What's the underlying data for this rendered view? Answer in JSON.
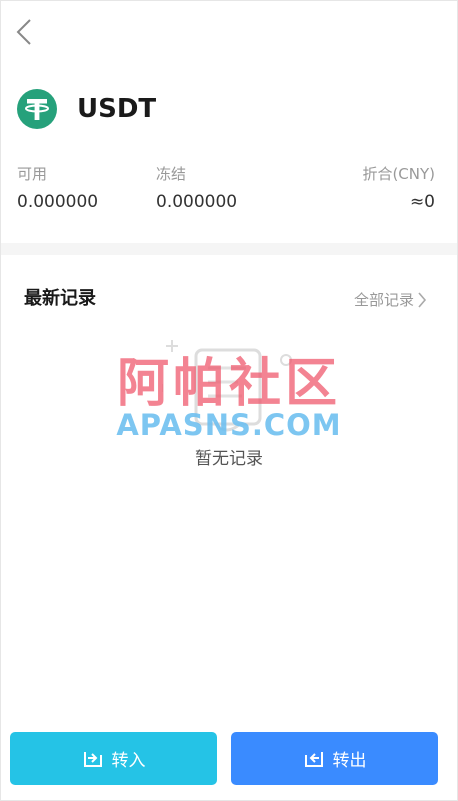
{
  "header": {
    "back_icon": "chevron-left-icon"
  },
  "coin": {
    "name": "USDT",
    "icon": "tether-icon",
    "icon_color": "#26a17b"
  },
  "stats": {
    "available": {
      "label": "可用",
      "value": "0.000000"
    },
    "frozen": {
      "label": "冻结",
      "value": "0.000000"
    },
    "converted": {
      "label": "折合(CNY)",
      "value": "≈0"
    }
  },
  "records": {
    "title": "最新记录",
    "all_label": "全部记录",
    "empty_text": "暂无记录"
  },
  "watermark": {
    "cn": "阿帕社区",
    "en": "APASNS.COM"
  },
  "actions": {
    "transfer_in": {
      "label": "转入",
      "color": "#25c3e6",
      "icon": "transfer-in-icon"
    },
    "transfer_out": {
      "label": "转出",
      "color": "#3a8bff",
      "icon": "transfer-out-icon"
    }
  }
}
